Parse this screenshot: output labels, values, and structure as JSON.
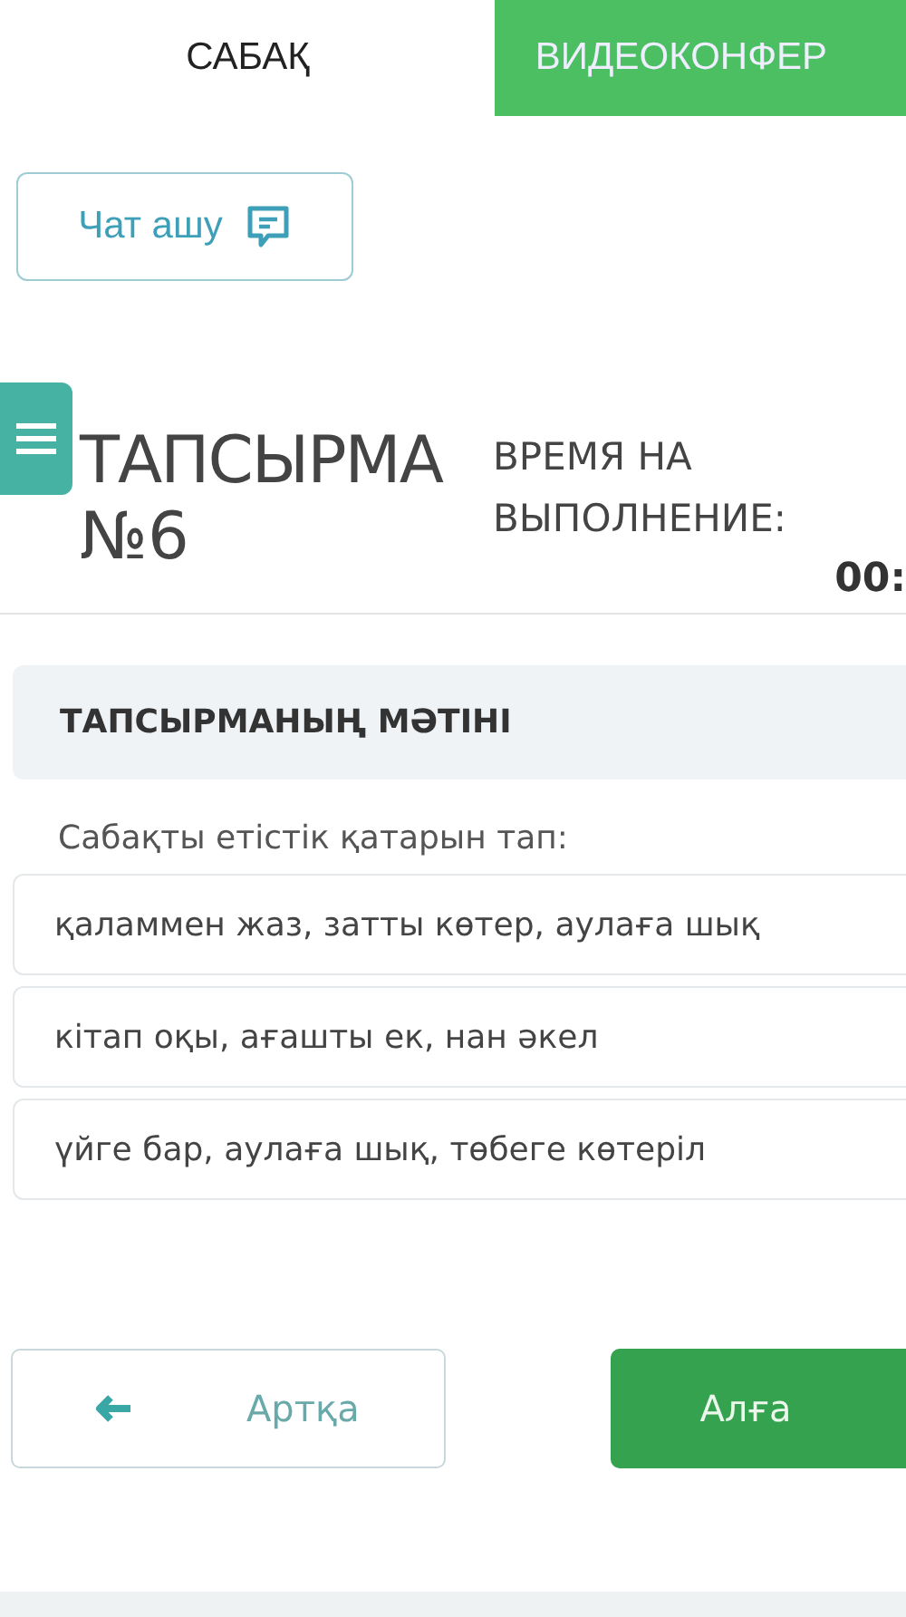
{
  "tabs": [
    {
      "label": "САБАҚ",
      "selected": false
    },
    {
      "label": "ВИДЕОКОНФЕР",
      "selected": true
    }
  ],
  "chat_button": {
    "label": "Чат ашу"
  },
  "task": {
    "title": "ТАПСЫРМА",
    "number": "№6",
    "time_label": "ВРЕМЯ НА ВЫПОЛНЕНИЕ:",
    "timer": "00:"
  },
  "section": {
    "title": "ТАПСЫРМАНЫҢ МӘТІНІ",
    "prompt": "Сабақты етістік қатарын тап:"
  },
  "options": [
    {
      "text": "қаламмен жаз, затты көтер, аулаға шық"
    },
    {
      "text": "кітап оқы, ағашты ек, нан әкел"
    },
    {
      "text": "үйге бар, аулаға шық, төбеге көтеріл"
    }
  ],
  "buttons": {
    "back": "Артқа",
    "next": "Алға"
  }
}
